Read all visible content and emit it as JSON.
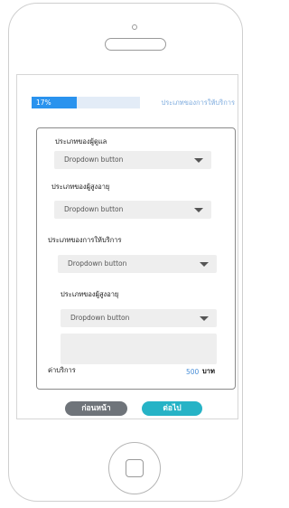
{
  "progress": {
    "percent_label": "17%",
    "percent_value": 17,
    "caption": "ประเภทของการให้บริการ"
  },
  "form": {
    "fields": [
      {
        "label": "ประเภทของผู้ดูแล",
        "dropdown": "Dropdown button"
      },
      {
        "label": "ประเภทของผู้สูงอายุ",
        "dropdown": "Dropdown button"
      },
      {
        "label": "ประเภทของการให้บริการ",
        "dropdown": "Dropdown button"
      },
      {
        "label": "ประเภทของผู้สูงอายุ",
        "dropdown": "Dropdown button"
      }
    ],
    "fee_label": "ค่าบริการ",
    "fee_value": "500",
    "fee_unit": "บาท"
  },
  "buttons": {
    "back_label": "ก่อนหน้า",
    "next_label": "ต่อไป"
  },
  "colors": {
    "progress_fill": "#2a93ee",
    "next_button": "#26b3c6",
    "back_button": "#6f747a"
  }
}
